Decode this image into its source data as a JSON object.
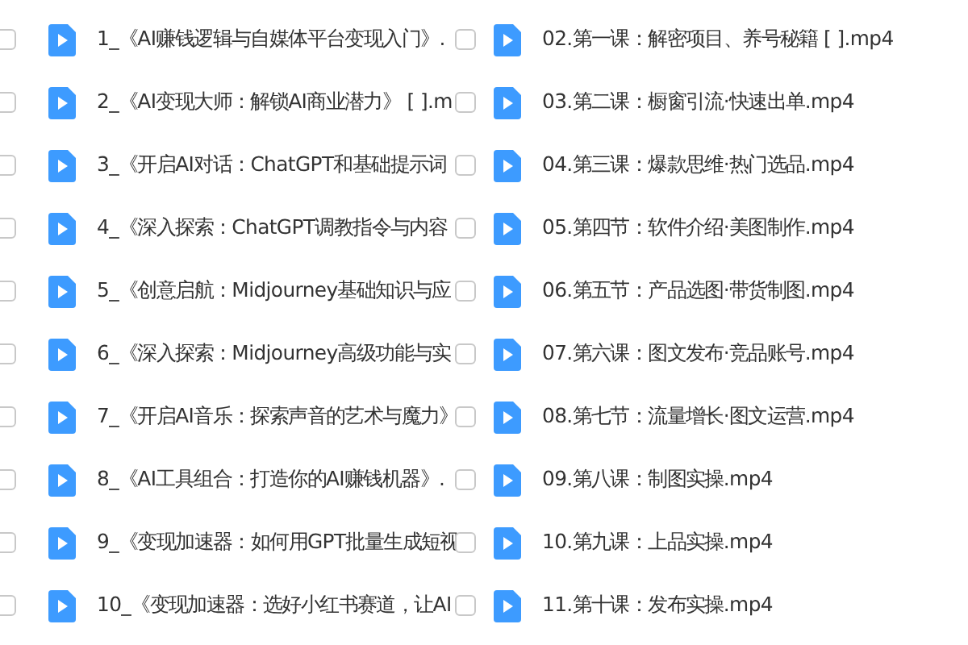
{
  "columns": [
    {
      "files": [
        {
          "name": "1_《AI赚钱逻辑与自媒体平台变现入门》.",
          "checked": false
        },
        {
          "name": "2_《AI变现大师：解锁AI商业潜力》 [  ].m",
          "checked": false
        },
        {
          "name": "3_《开启AI对话：ChatGPT和基础提示词",
          "checked": false
        },
        {
          "name": "4_《深入探索：ChatGPT调教指令与内容",
          "checked": false
        },
        {
          "name": "5_《创意启航：Midjourney基础知识与应",
          "checked": false
        },
        {
          "name": "6_《深入探索：Midjourney高级功能与实",
          "checked": false
        },
        {
          "name": "7_《开启AI音乐：探索声音的艺术与魔力》",
          "checked": false
        },
        {
          "name": "8_《AI工具组合：打造你的AI赚钱机器》.",
          "checked": false
        },
        {
          "name": "9_《变现加速器：如何用GPT批量生成短视",
          "checked": false
        },
        {
          "name": "10_《变现加速器：选好小红书赛道，让AI",
          "checked": false
        }
      ]
    },
    {
      "files": [
        {
          "name": "02.第一课：解密项目、养号秘籍 [  ].mp4",
          "checked": false
        },
        {
          "name": "03.第二课：橱窗引流·快速出单.mp4",
          "checked": false
        },
        {
          "name": "04.第三课：爆款思维·热门选品.mp4",
          "checked": false
        },
        {
          "name": "05.第四节：软件介绍·美图制作.mp4",
          "checked": false
        },
        {
          "name": "06.第五节：产品选图·带货制图.mp4",
          "checked": false
        },
        {
          "name": "07.第六课：图文发布·竞品账号.mp4",
          "checked": false
        },
        {
          "name": "08.第七节：流量增长·图文运营.mp4",
          "checked": false
        },
        {
          "name": "09.第八课：制图实操.mp4",
          "checked": false
        },
        {
          "name": "10.第九课：上品实操.mp4",
          "checked": false
        },
        {
          "name": "11.第十课：发布实操.mp4",
          "checked": false
        }
      ]
    }
  ]
}
